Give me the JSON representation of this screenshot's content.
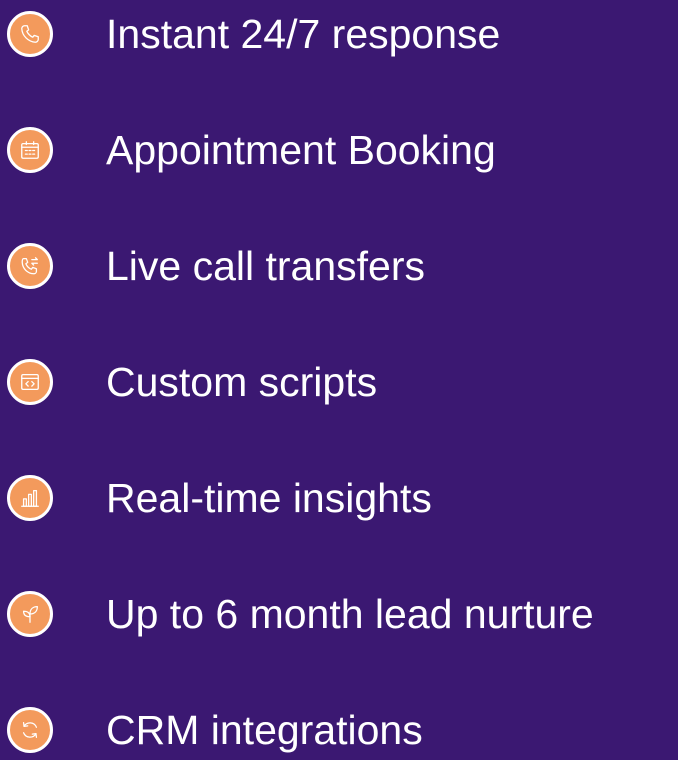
{
  "features": {
    "items": [
      {
        "label": "Instant 24/7 response",
        "icon": "phone-icon"
      },
      {
        "label": "Appointment Booking",
        "icon": "calendar-icon"
      },
      {
        "label": "Live call transfers",
        "icon": "phone-transfer-icon"
      },
      {
        "label": "Custom scripts",
        "icon": "code-window-icon"
      },
      {
        "label": "Real-time insights",
        "icon": "bar-chart-icon"
      },
      {
        "label": "Up to 6 month lead nurture",
        "icon": "sprout-icon"
      },
      {
        "label": "CRM integrations",
        "icon": "sync-icon"
      }
    ]
  },
  "colors": {
    "background": "#3b1872",
    "icon_fill": "#f39a5c",
    "icon_border": "#ffffff",
    "text": "#ffffff"
  }
}
